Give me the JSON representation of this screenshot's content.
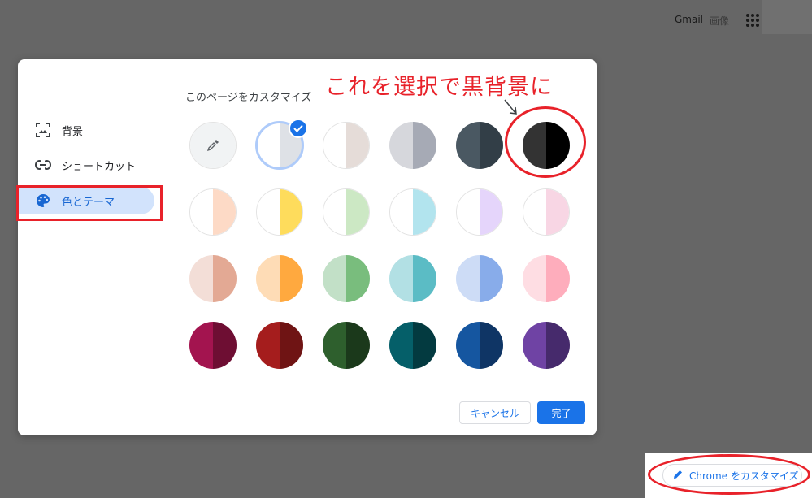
{
  "topbar": {
    "gmail": "Gmail",
    "images": "画像"
  },
  "dialog": {
    "title": "このページをカスタマイズ",
    "nav": [
      {
        "label": "背景",
        "icon": "background-image-icon"
      },
      {
        "label": "ショートカット",
        "icon": "link-icon"
      },
      {
        "label": "色とテーマ",
        "icon": "palette-icon",
        "active": true
      }
    ],
    "annotation": "これを選択で黒背景に",
    "themes": [
      [
        {
          "type": "picker",
          "left": "#f1f3f4",
          "right": "#f1f3f4"
        },
        {
          "left": "#ffffff",
          "right": "#dee1e6",
          "selected": true
        },
        {
          "left": "#ffffff",
          "right": "#e5dcd8"
        },
        {
          "left": "#d6d7dc",
          "right": "#a6aab5"
        },
        {
          "left": "#4a5862",
          "right": "#323e47"
        },
        {
          "left": "#333333",
          "right": "#000000",
          "highlighted": true
        }
      ],
      [
        {
          "left": "#ffffff",
          "right": "#fddac6"
        },
        {
          "left": "#ffffff",
          "right": "#fedc5c"
        },
        {
          "left": "#ffffff",
          "right": "#cce8c4"
        },
        {
          "left": "#ffffff",
          "right": "#b2e4ee"
        },
        {
          "left": "#ffffff",
          "right": "#e5d5fb"
        },
        {
          "left": "#ffffff",
          "right": "#f8d6e4"
        }
      ],
      [
        {
          "left": "#f3ded7",
          "right": "#e3a994"
        },
        {
          "left": "#fedcb6",
          "right": "#ffa93f"
        },
        {
          "left": "#c2e0c7",
          "right": "#79bd7d"
        },
        {
          "left": "#b2e0e4",
          "right": "#5bbcc5"
        },
        {
          "left": "#cddcf6",
          "right": "#88acea"
        },
        {
          "left": "#fedde3",
          "right": "#feadbc"
        }
      ],
      [
        {
          "left": "#a3144f",
          "right": "#6e0e33"
        },
        {
          "left": "#a51d1d",
          "right": "#6f1414"
        },
        {
          "left": "#2e5f2d",
          "right": "#1b391b"
        },
        {
          "left": "#055f69",
          "right": "#033a40"
        },
        {
          "left": "#1556a0",
          "right": "#0f3565"
        },
        {
          "left": "#6f43a4",
          "right": "#462a6c"
        }
      ]
    ],
    "cancel": "キャンセル",
    "done": "完了"
  },
  "customize_button": "Chrome をカスタマイズ",
  "colors": {
    "accent": "#1a73e8",
    "annotation_red": "#e8222a"
  }
}
